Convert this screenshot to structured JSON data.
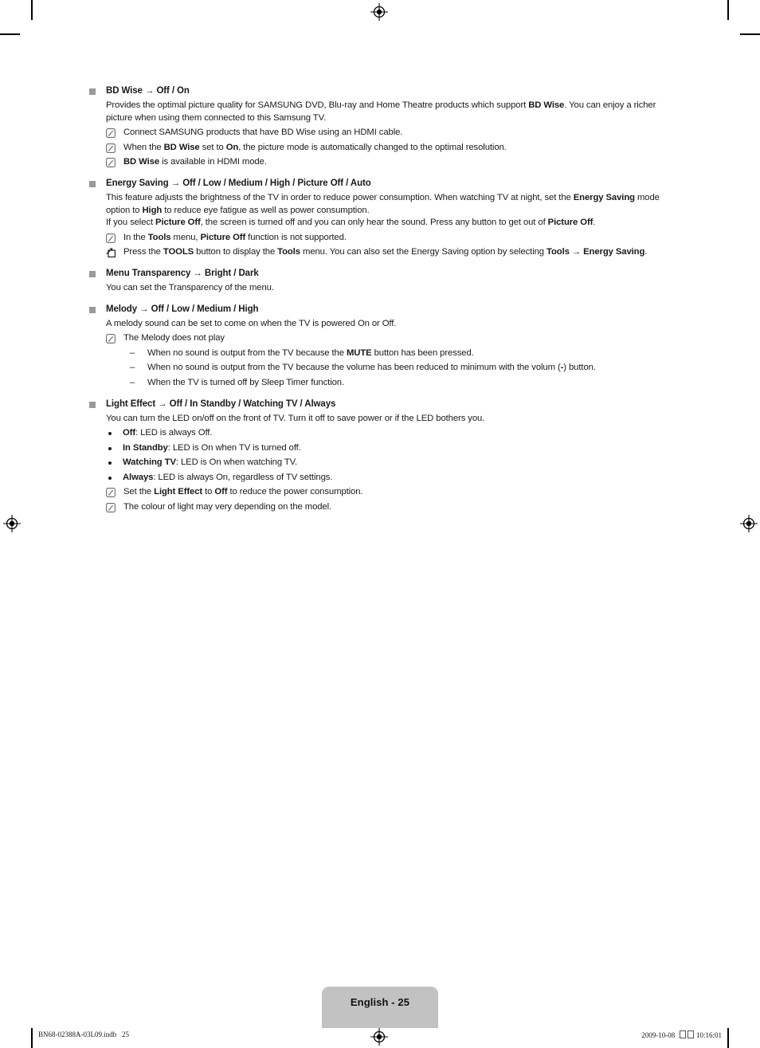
{
  "document": {
    "page_label": "English - 25",
    "footer_left": "BN68-02388A-03L09.indb   25",
    "footer_right_date": "2009-10-08",
    "footer_right_time": "10:16:01"
  },
  "icons": {
    "square_bullet": "square-bullet",
    "note": "note-pencil-icon",
    "tools": "tools-arrow-icon",
    "dash": "–",
    "registration": "registration-target-mark"
  },
  "sections": [
    {
      "id": "bd-wise",
      "heading_html": "BD Wise → <b>Off / On</b>",
      "heading_plain": "BD Wise → Off / On",
      "paragraphs": [
        "Provides the optimal picture quality for SAMSUNG DVD, Blu-ray and Home Theatre products which support <b>BD Wise</b>. You can enjoy a richer picture when using them connected to this Samsung TV."
      ],
      "notes": [
        {
          "icon": "note",
          "html": "Connect SAMSUNG products that have BD Wise using an HDMI cable."
        },
        {
          "icon": "note",
          "html": "When the <b>BD Wise</b> set to <b>On</b>, the picture mode is automatically changed to the optimal resolution."
        },
        {
          "icon": "note",
          "html": "<b>BD Wise</b> is available in HDMI mode."
        }
      ]
    },
    {
      "id": "energy-saving",
      "heading_html": "Energy Saving → <b>Off / Low / Medium / High / Picture Off / Auto</b>",
      "heading_plain": "Energy Saving → Off / Low / Medium / High / Picture Off / Auto",
      "paragraphs": [
        "This feature adjusts the brightness of the TV in order to reduce power consumption. When watching TV at night, set the <b>Energy Saving</b> mode option to <b>High</b> to reduce eye fatigue as well as power consumption.",
        "If you select <b>Picture Off</b>, the screen is turned off and you can only hear the sound. Press any button to get out of <b>Picture Off</b>."
      ],
      "notes": [
        {
          "icon": "note",
          "html": "In the <b>Tools</b> menu, <b>Picture Off</b> function is not supported."
        },
        {
          "icon": "tools",
          "html": "Press the <b>TOOLS</b> button to display the <b>Tools</b> menu. You can also set the Energy Saving option by selecting <b>Tools → Energy Saving</b>."
        }
      ]
    },
    {
      "id": "menu-transparency",
      "heading_html": "Menu Transparency → <b>Bright / Dark</b>",
      "heading_plain": "Menu Transparency → Bright / Dark",
      "paragraphs": [
        "You can set the Transparency of the menu."
      ],
      "notes": []
    },
    {
      "id": "melody",
      "heading_html": "Melody → <b>Off / Low / Medium / High</b>",
      "heading_plain": "Melody → Off / Low / Medium / High",
      "paragraphs": [
        "A melody sound can be set to come on when the TV is powered On or Off."
      ],
      "notes": [
        {
          "icon": "note",
          "html": "The Melody does not play"
        }
      ],
      "dashes": [
        "When no sound is output from the TV because the <b>MUTE</b> button has been pressed.",
        "When no sound is output from the TV because the volume has been reduced to minimum with the volum (<b>-</b>) button.",
        "When the TV is turned off by Sleep Timer function."
      ]
    },
    {
      "id": "light-effect",
      "heading_html": "Light Effect → <b>Off / In Standby / Watching TV / Always</b>",
      "heading_plain": "Light Effect → Off / In Standby / Watching TV / Always",
      "paragraphs": [
        "You can turn the LED on/off on the front of TV. Turn it off to save power or if the LED bothers you."
      ],
      "bullets": [
        "<b>Off</b>: LED is always Off.",
        "<b>In Standby</b>: LED is On when TV is turned off.",
        "<b>Watching TV</b>: LED is On when watching TV.",
        "<b>Always</b>: LED is always On, regardless of TV settings."
      ],
      "notes": [
        {
          "icon": "note",
          "html": "Set the <b>Light Effect</b> to <b>Off</b> to reduce the power consumption."
        },
        {
          "icon": "note",
          "html": "The colour of light may very depending on the model."
        }
      ]
    }
  ]
}
